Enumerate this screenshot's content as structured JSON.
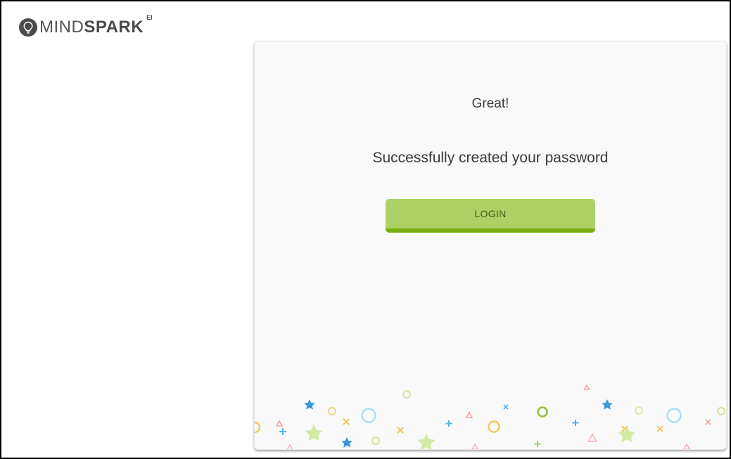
{
  "brand": {
    "name_light": "MIND",
    "name_bold": "SPARK",
    "superscript": "EI"
  },
  "card": {
    "headline": "Great!",
    "message": "Successfully created your password",
    "login_label": "LOGIN"
  },
  "colors": {
    "button": "#acd265",
    "button_shadow": "#78ae11",
    "card_background": "#f9f9f9"
  },
  "icons": {
    "brand": "lightbulb-icon"
  }
}
